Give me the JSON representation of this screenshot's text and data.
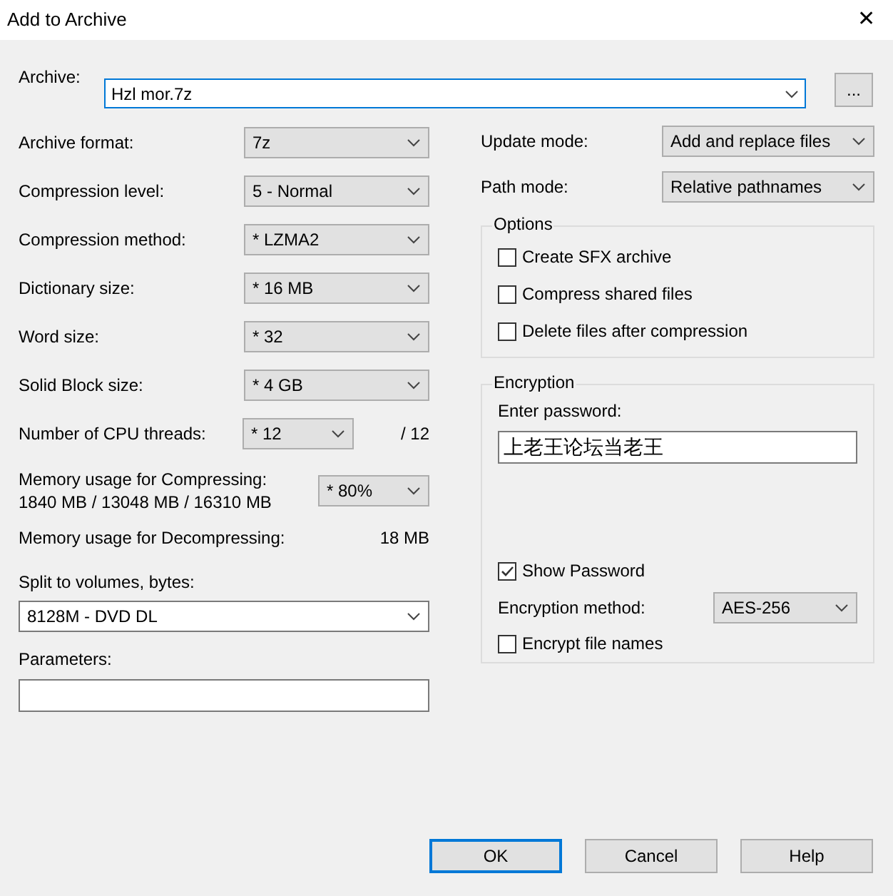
{
  "window": {
    "title": "Add to Archive",
    "close": "✕"
  },
  "archive": {
    "label": "Archive:",
    "value": "Hzl mor.7z",
    "browse": "..."
  },
  "left_fields": [
    {
      "kind": "select",
      "label": "Archive format:",
      "value": "7z"
    },
    {
      "kind": "select",
      "label": "Compression level:",
      "value": "5 - Normal"
    },
    {
      "kind": "select",
      "label": "Compression method:",
      "value": "* LZMA2"
    },
    {
      "kind": "select",
      "label": "Dictionary size:",
      "value": "* 16 MB"
    },
    {
      "kind": "select",
      "label": "Word size:",
      "value": "* 32"
    },
    {
      "kind": "select",
      "label": "Solid Block size:",
      "value": "* 4 GB"
    },
    {
      "kind": "threads",
      "label": "Number of CPU threads:",
      "value": "* 12",
      "suffix": "/ 12"
    },
    {
      "kind": "memory",
      "label": "Memory usage for Compressing:",
      "detail": "1840 MB / 13048 MB / 16310 MB",
      "value": "* 80%"
    },
    {
      "kind": "readout",
      "label": "Memory usage for Decompressing:",
      "value": "18 MB"
    }
  ],
  "split": {
    "label": "Split to volumes, bytes:",
    "value": "8128M - DVD DL"
  },
  "parameters": {
    "label": "Parameters:"
  },
  "update_mode": {
    "label": "Update mode:",
    "value": "Add and replace files"
  },
  "path_mode": {
    "label": "Path mode:",
    "value": "Relative pathnames"
  },
  "options": {
    "title": "Options",
    "items": [
      {
        "label": "Create SFX archive",
        "checked": false
      },
      {
        "label": "Compress shared files",
        "checked": false
      },
      {
        "label": "Delete files after compression",
        "checked": false
      }
    ]
  },
  "encryption": {
    "title": "Encryption",
    "password_label": "Enter password:",
    "password": "上老王论坛当老王",
    "show_password": {
      "label": "Show Password",
      "checked": true
    },
    "method_label": "Encryption method:",
    "method": "AES-256",
    "encrypt_names": {
      "label": "Encrypt file names",
      "checked": false
    }
  },
  "buttons": [
    {
      "label": "OK",
      "default": true
    },
    {
      "label": "Cancel",
      "default": false
    },
    {
      "label": "Help",
      "default": false
    }
  ]
}
